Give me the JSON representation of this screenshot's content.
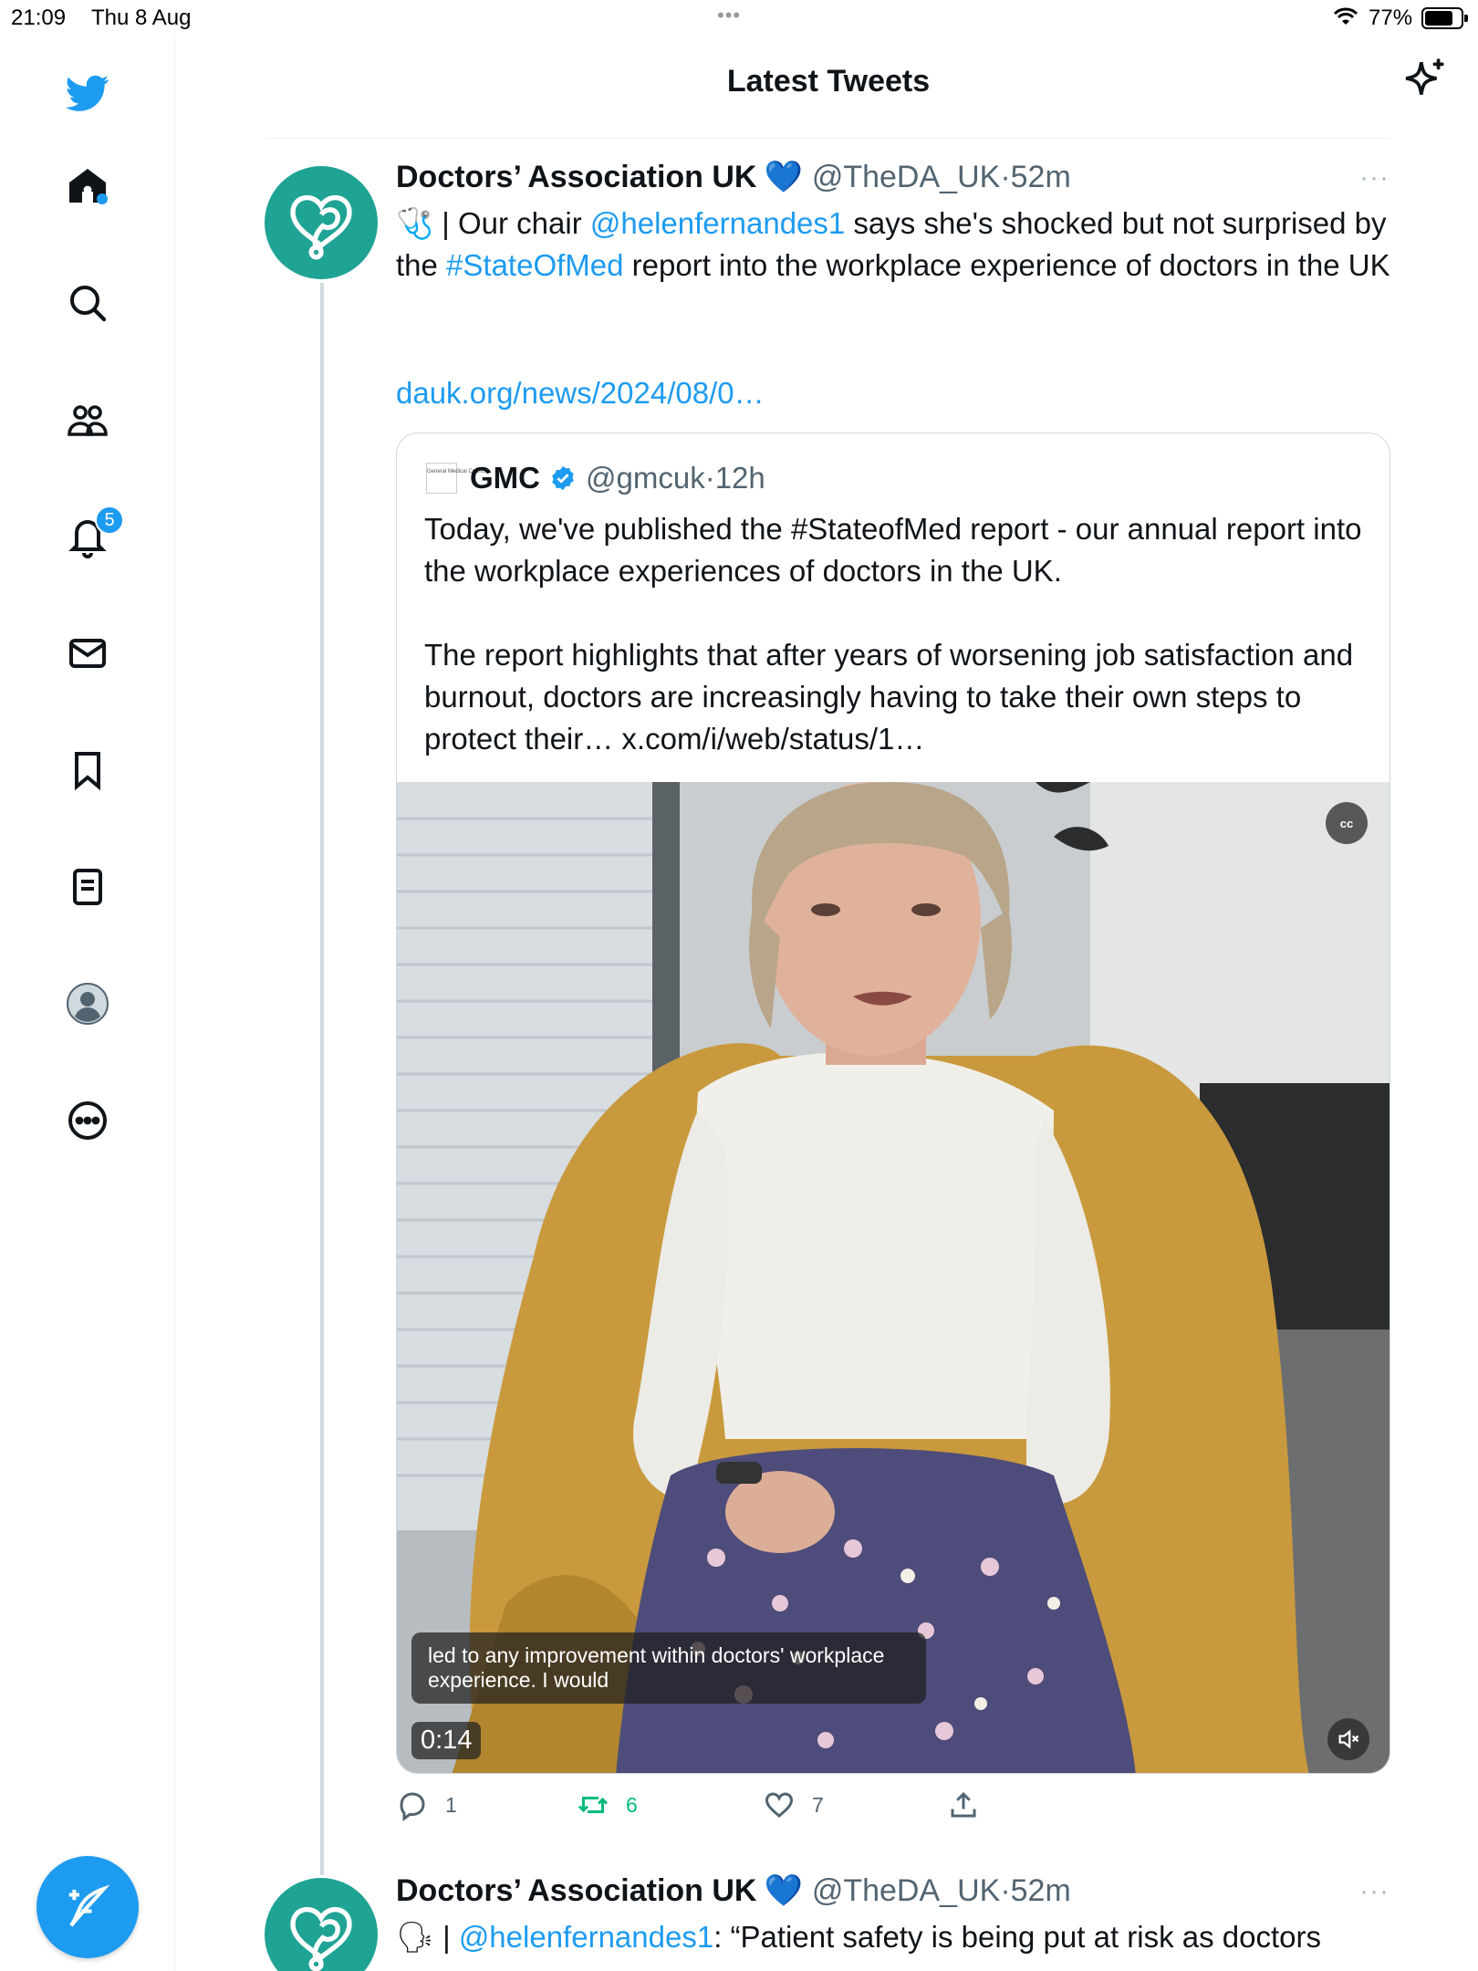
{
  "status_bar": {
    "time": "21:09",
    "date": "Thu 8 Aug",
    "dots": "•••",
    "battery": "77%"
  },
  "sidebar": {
    "notifications_badge": "5",
    "items": [
      "twitter-logo",
      "home",
      "search",
      "communities",
      "notifications",
      "messages",
      "bookmarks",
      "lists",
      "profile",
      "more"
    ]
  },
  "header": {
    "title": "Latest Tweets"
  },
  "tweet1": {
    "name": "Doctors’ Association UK",
    "heart": "💙",
    "handle": "@TheDA_UK",
    "sep": "·",
    "ago": "52m",
    "more": "···",
    "text_pre": "🩺 | Our chair ",
    "mention": "@helenfernandes1",
    "text_mid": " says she's shocked but not surprised by the ",
    "hashtag": "#StateOfMed",
    "text_post": " report into the workplace experience of doctors in the UK",
    "link": "dauk.org/news/2024/08/0…",
    "quote": {
      "logo_text": "General Medical Council",
      "name": "GMC",
      "handle": "@gmcuk",
      "sep": "·",
      "ago": "12h",
      "para1": "Today, we've published the #StateofMed report - our annual report into the workplace experiences of doctors in the UK.",
      "para2": "The report highlights that after years of worsening job satisfaction and burnout, doctors are increasingly having to take their own steps to protect their… x.com/i/web/status/1…",
      "video": {
        "cc": "cc",
        "caption": "led to any improvement within doctors' workplace experience. I would",
        "duration": "0:14"
      }
    },
    "actions": {
      "replies": "1",
      "retweets": "6",
      "likes": "7"
    }
  },
  "tweet2": {
    "name": "Doctors’ Association UK",
    "heart": "💙",
    "handle": "@TheDA_UK",
    "sep": "·",
    "ago": "52m",
    "more": "···",
    "text_pre": "🗣 | ",
    "mention": "@helenfernandes1",
    "text_post": ":  “Patient safety is being put at risk as doctors"
  },
  "colors": {
    "accent": "#1d9bf0",
    "avatar_bg": "#1fa394",
    "retweet": "#00ba7c",
    "secondary_text": "#536471"
  }
}
